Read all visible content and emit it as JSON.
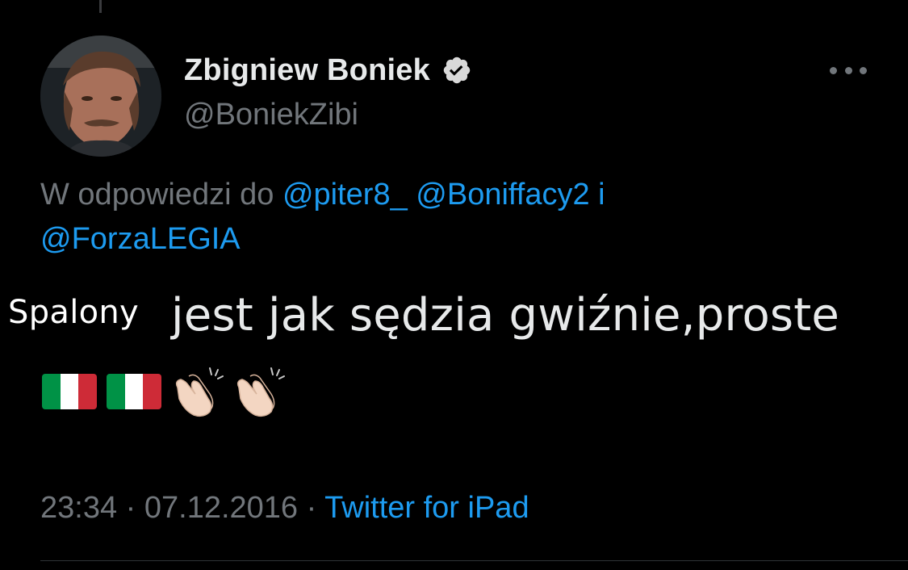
{
  "author": {
    "display_name": "Zbigniew Boniek",
    "handle": "@BoniekZibi",
    "verified": true
  },
  "reply_context": {
    "prefix": "W odpowiedzi do",
    "mentions": [
      "@piter8_",
      "@Boniffacy2",
      "@ForzaLEGIA"
    ],
    "conjunction": "i"
  },
  "overlay_text": "Spalony",
  "tweet": {
    "text": "jest jak sędzia gwiźnie,proste",
    "emojis": [
      "italy-flag",
      "italy-flag",
      "clapping-hands",
      "clapping-hands"
    ]
  },
  "meta": {
    "time": "23:34",
    "separator": "·",
    "date": "07.12.2016",
    "source": "Twitter for iPad"
  },
  "colors": {
    "background": "#000000",
    "primary_text": "#e7e9ea",
    "secondary_text": "#71767b",
    "link": "#1d9bf0"
  }
}
